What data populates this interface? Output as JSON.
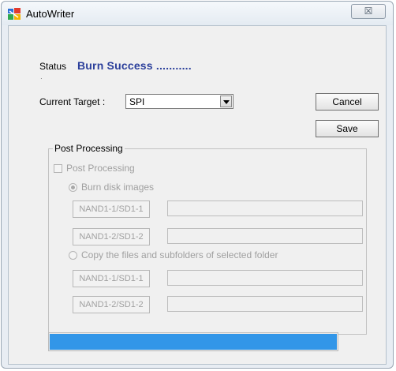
{
  "window": {
    "title": "AutoWriter",
    "close_glyph": "☒",
    "icon": "app-colorful-icon"
  },
  "status": {
    "label": "Status",
    "value": "Burn Success ..........."
  },
  "target": {
    "label": "Current Target :",
    "selected": "SPI"
  },
  "buttons": {
    "cancel": "Cancel",
    "save": "Save"
  },
  "post": {
    "group_title": "Post Processing",
    "checkbox_label": "Post Processing",
    "checkbox_checked": false,
    "burn_label": "Burn disk images",
    "burn_selected": true,
    "burn_btn1": "NAND1-1/SD1-1",
    "burn_btn2": "NAND1-2/SD1-2",
    "copy_label": "Copy the files and subfolders of selected folder",
    "copy_selected": false,
    "copy_btn1": "NAND1-1/SD1-1",
    "copy_btn2": "NAND1-2/SD1-2"
  },
  "progress": {
    "fraction": 1.0,
    "color": "#3296e8"
  },
  "colors": {
    "status_text": "#2b3f9b"
  }
}
